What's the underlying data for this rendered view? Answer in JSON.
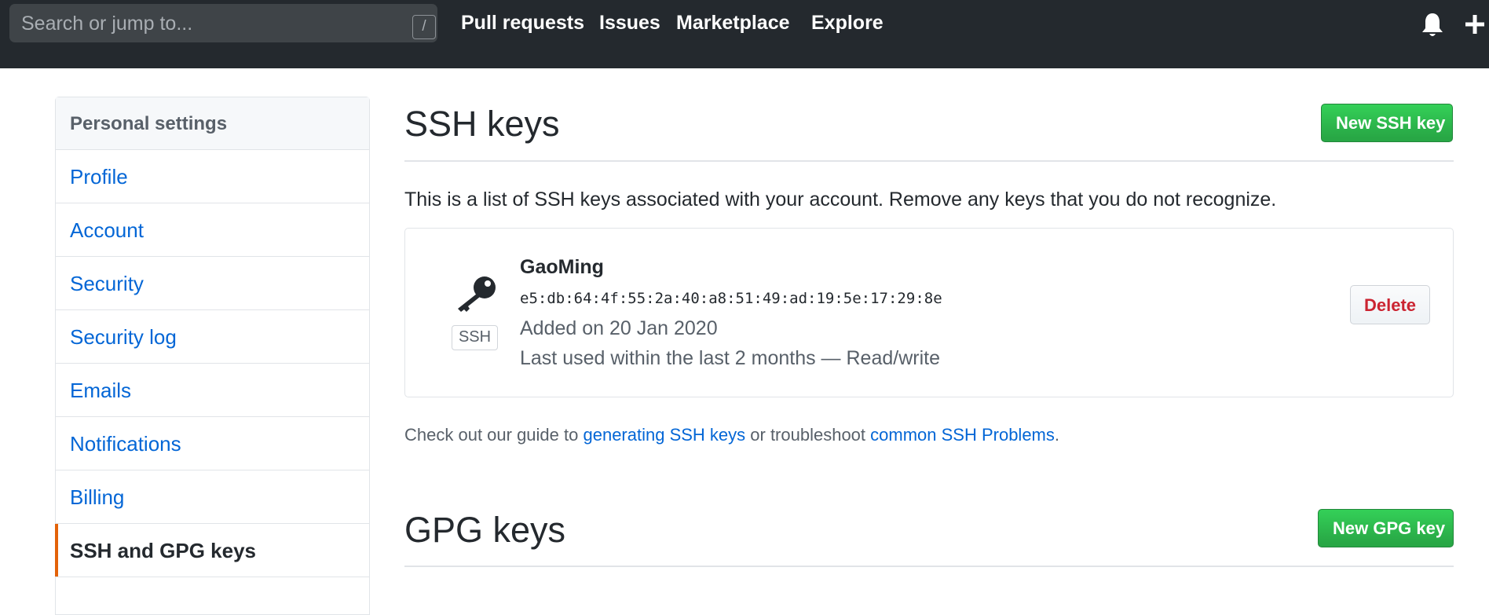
{
  "header": {
    "search_placeholder": "Search or jump to...",
    "search_shortcut": "/",
    "nav": [
      "Pull requests",
      "Issues",
      "Marketplace",
      "Explore"
    ],
    "icons": [
      "bell-icon",
      "plus-icon"
    ],
    "background_color": "#24292e"
  },
  "sidebar": {
    "heading": "Personal settings",
    "items": [
      {
        "label": "Profile"
      },
      {
        "label": "Account"
      },
      {
        "label": "Security"
      },
      {
        "label": "Security log"
      },
      {
        "label": "Emails"
      },
      {
        "label": "Notifications"
      },
      {
        "label": "Billing"
      },
      {
        "label": "SSH and GPG keys",
        "active": true
      }
    ],
    "active_marker_color": "#e36209"
  },
  "ssh": {
    "title": "SSH keys",
    "new_button": "New SSH key",
    "intro": "This is a list of SSH keys associated with your account. Remove any keys that you do not recognize.",
    "keys": [
      {
        "badge": "SSH",
        "name": "GaoMing",
        "fingerprint": "e5:db:64:4f:55:2a:40:a8:51:49:ad:19:5e:17:29:8e",
        "added": "Added on 20 Jan 2020",
        "last_used": "Last used within the last 2 months — Read/write",
        "delete_label": "Delete",
        "icon": "key-icon"
      }
    ],
    "guide": {
      "prefix": "Check out our guide to ",
      "link1": "generating SSH keys",
      "middle": " or troubleshoot ",
      "link2": "common SSH Problems",
      "suffix": "."
    }
  },
  "gpg": {
    "title": "GPG keys",
    "new_button": "New GPG key"
  },
  "colors": {
    "accent_green": "#2ea44f",
    "link_blue": "#0366d6",
    "danger_red": "#cb2431"
  }
}
